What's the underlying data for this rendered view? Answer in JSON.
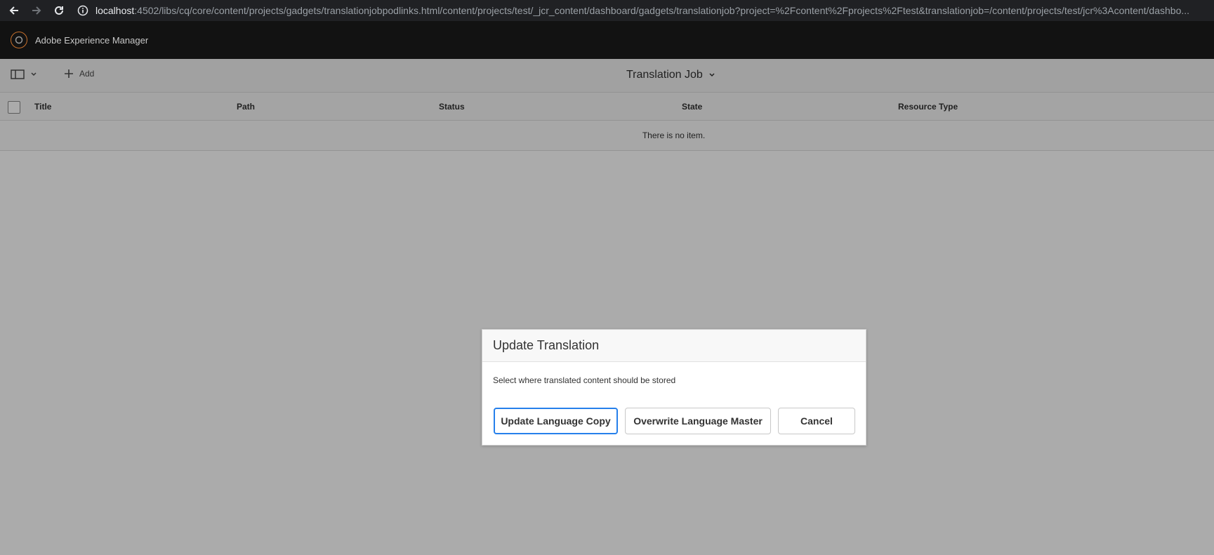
{
  "browser": {
    "url_host": "localhost",
    "url_rest": ":4502/libs/cq/core/content/projects/gadgets/translationjobpodlinks.html/content/projects/test/_jcr_content/dashboard/gadgets/translationjob?project=%2Fcontent%2Fprojects%2Ftest&translationjob=/content/projects/test/jcr%3Acontent/dashbo..."
  },
  "header": {
    "brand": "Adobe Experience Manager"
  },
  "toolbar": {
    "add_label": "Add",
    "title": "Translation Job"
  },
  "table": {
    "columns": [
      "Title",
      "Path",
      "Status",
      "State",
      "Resource Type"
    ],
    "empty_message": "There is no item."
  },
  "dialog": {
    "title": "Update Translation",
    "message": "Select where translated content should be stored",
    "buttons": {
      "update_copy": "Update Language Copy",
      "overwrite_master": "Overwrite Language Master",
      "cancel": "Cancel"
    }
  },
  "colors": {
    "accent": "#2680eb",
    "header_bg": "#121212",
    "logo": "#c7702c"
  }
}
